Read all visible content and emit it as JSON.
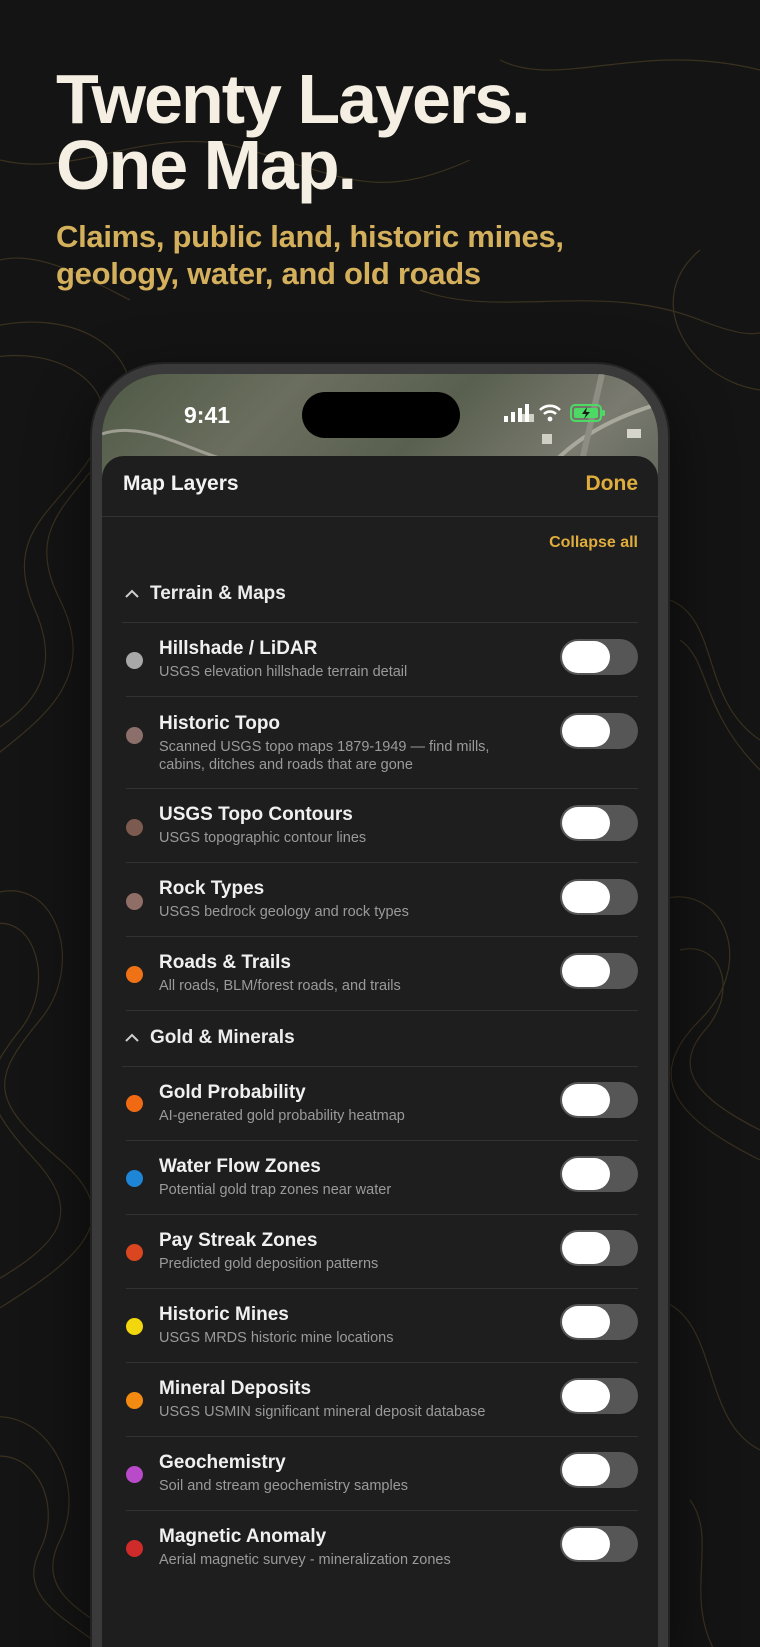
{
  "headline": {
    "line1": "Twenty Layers.",
    "line2": "One Map."
  },
  "subline": {
    "line1": "Claims, public land, historic mines,",
    "line2": "geology, water, and old roads"
  },
  "status_bar": {
    "time": "9:41"
  },
  "sheet": {
    "title": "Map Layers",
    "done_label": "Done",
    "collapse_label": "Collapse all"
  },
  "sections": [
    {
      "title": "Terrain & Maps",
      "layers": [
        {
          "title": "Hillshade / LiDAR",
          "desc": "USGS elevation hillshade terrain detail",
          "color": "#a8a8a8",
          "enabled": false
        },
        {
          "title": "Historic Topo",
          "desc": "Scanned USGS topo maps 1879-1949 — find mills, cabins, ditches and roads that are gone",
          "color": "#8c6f6a",
          "enabled": false
        },
        {
          "title": "USGS Topo Contours",
          "desc": "USGS topographic contour lines",
          "color": "#7d5a4f",
          "enabled": false
        },
        {
          "title": "Rock Types",
          "desc": "USGS bedrock geology and rock types",
          "color": "#8f6e66",
          "enabled": false
        },
        {
          "title": "Roads & Trails",
          "desc": "All roads, BLM/forest roads, and trails",
          "color": "#f07216",
          "enabled": false
        }
      ]
    },
    {
      "title": "Gold & Minerals",
      "layers": [
        {
          "title": "Gold Probability",
          "desc": "AI-generated gold probability heatmap",
          "color": "#f06a14",
          "enabled": false
        },
        {
          "title": "Water Flow Zones",
          "desc": "Potential gold trap zones near water",
          "color": "#1e86d6",
          "enabled": false
        },
        {
          "title": "Pay Streak Zones",
          "desc": "Predicted gold deposition patterns",
          "color": "#d9461f",
          "enabled": false
        },
        {
          "title": "Historic Mines",
          "desc": "USGS MRDS historic mine locations",
          "color": "#f2d60e",
          "enabled": false
        },
        {
          "title": "Mineral Deposits",
          "desc": "USGS USMIN significant mineral deposit database",
          "color": "#f38a12",
          "enabled": false
        },
        {
          "title": "Geochemistry",
          "desc": "Soil and stream geochemistry samples",
          "color": "#b94ac9",
          "enabled": false
        },
        {
          "title": "Magnetic Anomaly",
          "desc": "Aerial magnetic survey - mineralization zones",
          "color": "#cf2b2b",
          "enabled": false
        }
      ]
    }
  ]
}
